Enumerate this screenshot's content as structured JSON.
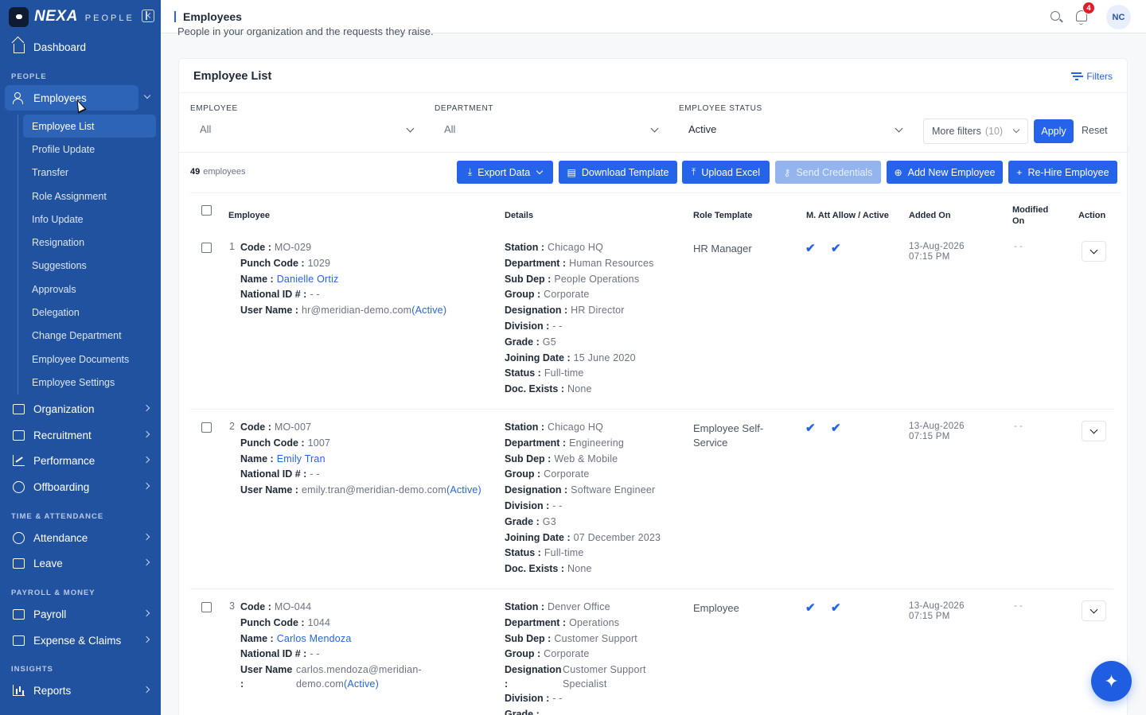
{
  "brand": {
    "name": "NEXA",
    "sub": "PEOPLE"
  },
  "sidebar": {
    "dashboard": "Dashboard",
    "sections": {
      "people": "PEOPLE",
      "time": "TIME & ATTENDANCE",
      "payroll": "PAYROLL & MONEY",
      "insights": "INSIGHTS"
    },
    "employees": "Employees",
    "sub_items": [
      "Employee List",
      "Profile Update",
      "Transfer",
      "Role Assignment",
      "Info Update",
      "Resignation",
      "Suggestions",
      "Approvals",
      "Delegation",
      "Change Department",
      "Employee Documents",
      "Employee Settings"
    ],
    "organization": "Organization",
    "recruitment": "Recruitment",
    "performance": "Performance",
    "offboarding": "Offboarding",
    "attendance": "Attendance",
    "leave": "Leave",
    "payroll": "Payroll",
    "expense": "Expense & Claims",
    "reports": "Reports"
  },
  "topbar": {
    "title": "Employees",
    "notif_count": "4",
    "avatar": "NC"
  },
  "intro": "People in your organization and the requests they raise.",
  "card": {
    "title": "Employee List",
    "filters_link": "Filters",
    "filters": {
      "employee_label": "EMPLOYEE",
      "employee_value": "All",
      "department_label": "DEPARTMENT",
      "department_value": "All",
      "status_label": "EMPLOYEE STATUS",
      "status_value": "Active",
      "more_filters": "More filters",
      "more_count": "(10)",
      "apply": "Apply",
      "reset": "Reset"
    },
    "count_num": "49",
    "count_label": "employees",
    "buttons": {
      "export": "Export Data",
      "download": "Download Template",
      "upload": "Upload Excel",
      "send": "Send Credentials",
      "add": "Add New Employee",
      "rehire": "Re-Hire Employee"
    },
    "headers": {
      "employee": "Employee",
      "details": "Details",
      "role": "Role Template",
      "att": "M. Att Allow / Active",
      "added": "Added On",
      "modified_1": "Modified",
      "modified_2": "On",
      "action": "Action"
    }
  },
  "labels": {
    "code": "Code :",
    "punch": "Punch Code :",
    "name": "Name :",
    "nid": "National ID # :",
    "user": "User Name :",
    "station": "Station :",
    "department": "Department :",
    "subdep": "Sub Dep :",
    "group": "Group :",
    "designation": "Designation :",
    "division": "Division :",
    "grade": "Grade :",
    "joining": "Joining Date :",
    "status": "Status :",
    "docs": "Doc. Exists :",
    "user_a": "User Name",
    "colon": ":",
    "designation_a": "Designation"
  },
  "rows": [
    {
      "num": "1",
      "code": "MO-029",
      "punch": "1029",
      "name": "Danielle Ortiz",
      "nid": "- -",
      "user": "hr@meridian-demo.com",
      "user_status": "(Active)",
      "station": "Chicago HQ",
      "department": "Human Resources",
      "subdep": "People Operations",
      "group": "Corporate",
      "designation": "HR Director",
      "division": "- -",
      "grade": "G5",
      "joining": "15 June 2020",
      "status": "Full-time",
      "docs": "None",
      "role_1": "HR Manager",
      "role_2": "",
      "added_date": "13-Aug-2026",
      "added_time": "07:15 PM",
      "modified": "- -"
    },
    {
      "num": "2",
      "code": "MO-007",
      "punch": "1007",
      "name": "Emily Tran",
      "nid": "- -",
      "user": "emily.tran@meridian-demo.com",
      "user_status": "(Active)",
      "station": "Chicago HQ",
      "department": "Engineering",
      "subdep": "Web & Mobile",
      "group": "Corporate",
      "designation": "Software Engineer",
      "division": "- -",
      "grade": "G3",
      "joining": "07 December 2023",
      "status": "Full-time",
      "docs": "None",
      "role_1": "Employee Self-",
      "role_2": "Service",
      "added_date": "13-Aug-2026",
      "added_time": "07:15 PM",
      "modified": "- -"
    },
    {
      "num": "3",
      "code": "MO-044",
      "punch": "1044",
      "name": "Carlos Mendoza",
      "nid": "- -",
      "user_1": "carlos.mendoza@meridian-",
      "user_2": "demo.com",
      "user_status": "(Active)",
      "station": "Denver Office",
      "department": "Operations",
      "subdep": "Customer Support",
      "group": "Corporate",
      "designation_1": "Customer Support",
      "designation_2": "Specialist",
      "division": "- -",
      "role_1": "Employee",
      "added_date": "13-Aug-2026",
      "added_time": "07:15 PM",
      "modified": "- -"
    }
  ],
  "tick": "✔",
  "colors": {
    "sidebar": "#21529f",
    "accent": "#2563eb",
    "badge": "#e11d2a"
  }
}
